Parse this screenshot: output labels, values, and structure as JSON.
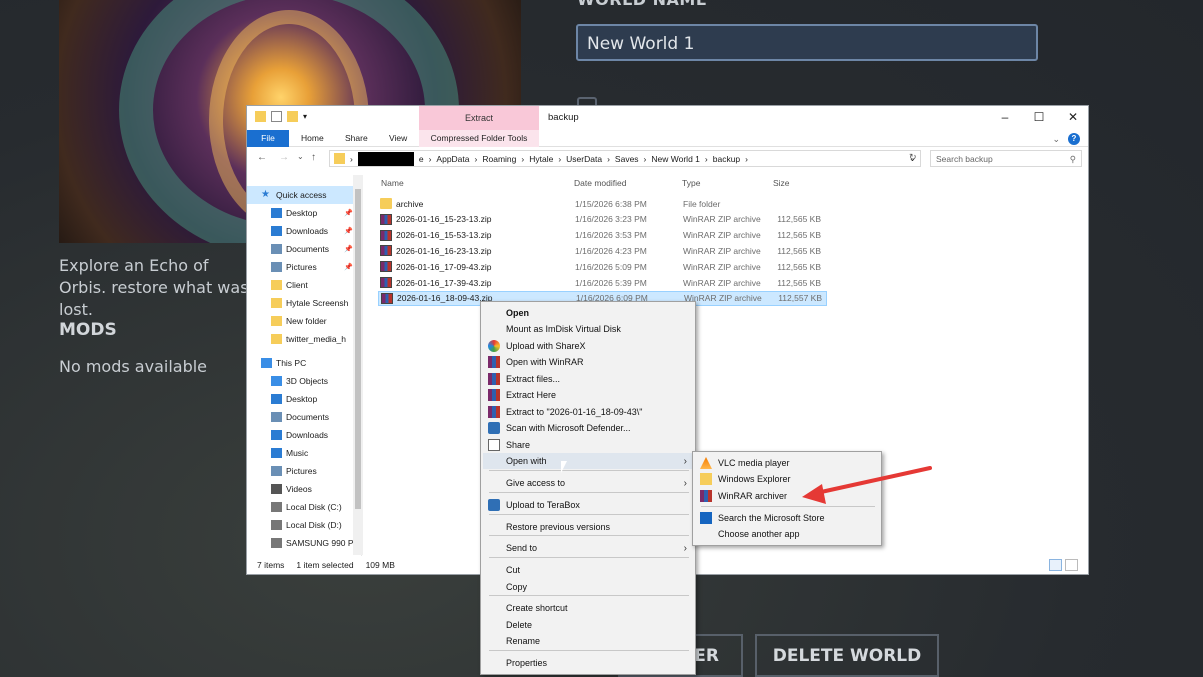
{
  "background": {
    "world_name_label": "WORLD NAME",
    "world_name_value": "New World 1",
    "description": "Explore an Echo of Orbis. restore what was lost.",
    "mods_heading": "MODS",
    "mods_empty": "No mods available",
    "button_partial": "ER",
    "delete_button": "DELETE WORLD"
  },
  "explorer": {
    "title": "backup",
    "extract_tab": "Extract",
    "ribbon_tabs": {
      "file": "File",
      "home": "Home",
      "share": "Share",
      "view": "View",
      "cft": "Compressed Folder Tools"
    },
    "breadcrumb": [
      "e",
      "AppData",
      "Roaming",
      "Hytale",
      "UserData",
      "Saves",
      "New World 1",
      "backup"
    ],
    "search_placeholder": "Search backup",
    "nav": [
      {
        "label": "Quick access",
        "icon": "star-icon",
        "color": "#2b7cd3",
        "pinned": false
      },
      {
        "label": "Desktop",
        "icon": "desktop-icon",
        "color": "#2b7cd3",
        "pinned": true
      },
      {
        "label": "Downloads",
        "icon": "download-icon",
        "color": "#2b7cd3",
        "pinned": true
      },
      {
        "label": "Documents",
        "icon": "documents-icon",
        "color": "#6a8fb5",
        "pinned": true
      },
      {
        "label": "Pictures",
        "icon": "pictures-icon",
        "color": "#6a8fb5",
        "pinned": true
      },
      {
        "label": "Client",
        "icon": "folder-icon",
        "color": "#f6cd5a",
        "pinned": false
      },
      {
        "label": "Hytale Screensh",
        "icon": "folder-icon",
        "color": "#f6cd5a",
        "pinned": false
      },
      {
        "label": "New folder",
        "icon": "folder-icon",
        "color": "#f6cd5a",
        "pinned": false
      },
      {
        "label": "twitter_media_h",
        "icon": "folder-icon",
        "color": "#f6cd5a",
        "pinned": false
      },
      {
        "label": "This PC",
        "icon": "computer-icon",
        "color": "#3a8ee6",
        "pinned": false
      },
      {
        "label": "3D Objects",
        "icon": "cube-icon",
        "color": "#3a8ee6",
        "pinned": false
      },
      {
        "label": "Desktop",
        "icon": "desktop-icon",
        "color": "#2b7cd3",
        "pinned": false
      },
      {
        "label": "Documents",
        "icon": "documents-icon",
        "color": "#6a8fb5",
        "pinned": false
      },
      {
        "label": "Downloads",
        "icon": "download-icon",
        "color": "#2b7cd3",
        "pinned": false
      },
      {
        "label": "Music",
        "icon": "music-icon",
        "color": "#2b7cd3",
        "pinned": false
      },
      {
        "label": "Pictures",
        "icon": "pictures-icon",
        "color": "#6a8fb5",
        "pinned": false
      },
      {
        "label": "Videos",
        "icon": "videos-icon",
        "color": "#555",
        "pinned": false
      },
      {
        "label": "Local Disk (C:)",
        "icon": "disk-icon",
        "color": "#777",
        "pinned": false
      },
      {
        "label": "Local Disk (D:)",
        "icon": "disk-icon",
        "color": "#777",
        "pinned": false
      },
      {
        "label": "SAMSUNG 990 P",
        "icon": "disk-icon",
        "color": "#777",
        "pinned": false
      }
    ],
    "columns": {
      "name": "Name",
      "date": "Date modified",
      "type": "Type",
      "size": "Size"
    },
    "files": [
      {
        "name": "archive",
        "date": "1/15/2026 6:38 PM",
        "type": "File folder",
        "size": "",
        "kind": "folder"
      },
      {
        "name": "2026-01-16_15-23-13.zip",
        "date": "1/16/2026 3:23 PM",
        "type": "WinRAR ZIP archive",
        "size": "112,565 KB",
        "kind": "rar"
      },
      {
        "name": "2026-01-16_15-53-13.zip",
        "date": "1/16/2026 3:53 PM",
        "type": "WinRAR ZIP archive",
        "size": "112,565 KB",
        "kind": "rar"
      },
      {
        "name": "2026-01-16_16-23-13.zip",
        "date": "1/16/2026 4:23 PM",
        "type": "WinRAR ZIP archive",
        "size": "112,565 KB",
        "kind": "rar"
      },
      {
        "name": "2026-01-16_17-09-43.zip",
        "date": "1/16/2026 5:09 PM",
        "type": "WinRAR ZIP archive",
        "size": "112,565 KB",
        "kind": "rar"
      },
      {
        "name": "2026-01-16_17-39-43.zip",
        "date": "1/16/2026 5:39 PM",
        "type": "WinRAR ZIP archive",
        "size": "112,565 KB",
        "kind": "rar"
      },
      {
        "name": "2026-01-16_18-09-43.zip",
        "date": "1/16/2026 6:09 PM",
        "type": "WinRAR ZIP archive",
        "size": "112,557 KB",
        "kind": "rar",
        "selected": true
      }
    ],
    "status": {
      "items": "7 items",
      "selected": "1 item selected",
      "size": "109 MB"
    }
  },
  "context_menu": {
    "items": [
      {
        "label": "Open",
        "bold": true
      },
      {
        "label": "Mount as ImDisk Virtual Disk"
      },
      {
        "label": "Upload with ShareX",
        "icon": "sharex-icon"
      },
      {
        "label": "Open with WinRAR",
        "icon": "winrar-icon"
      },
      {
        "label": "Extract files...",
        "icon": "winrar-icon"
      },
      {
        "label": "Extract Here",
        "icon": "winrar-icon"
      },
      {
        "label": "Extract to \"2026-01-16_18-09-43\\\"",
        "icon": "winrar-icon"
      },
      {
        "label": "Scan with Microsoft Defender...",
        "icon": "defender-icon"
      },
      {
        "label": "Share",
        "icon": "share-icon"
      },
      {
        "label": "Open with",
        "submenu": true,
        "highlighted": true
      },
      {
        "label": "Give access to",
        "submenu": true
      },
      {
        "label": "Upload to TeraBox",
        "icon": "terabox-icon"
      },
      {
        "label": "Restore previous versions"
      },
      {
        "label": "Send to",
        "submenu": true
      },
      {
        "label": "Cut"
      },
      {
        "label": "Copy"
      },
      {
        "label": "Create shortcut"
      },
      {
        "label": "Delete"
      },
      {
        "label": "Rename"
      },
      {
        "label": "Properties"
      }
    ]
  },
  "open_with_submenu": {
    "items": [
      {
        "label": "VLC media player",
        "icon": "vlc-icon"
      },
      {
        "label": "Windows Explorer",
        "icon": "explorer-icon"
      },
      {
        "label": "WinRAR archiver",
        "icon": "winrar-icon"
      },
      {
        "label": "Search the Microsoft Store",
        "icon": "store-icon"
      },
      {
        "label": "Choose another app"
      }
    ]
  },
  "colors": {
    "annotation_arrow": "#e53935",
    "accent": "#1a6fd0",
    "selection": "#cce8ff"
  }
}
